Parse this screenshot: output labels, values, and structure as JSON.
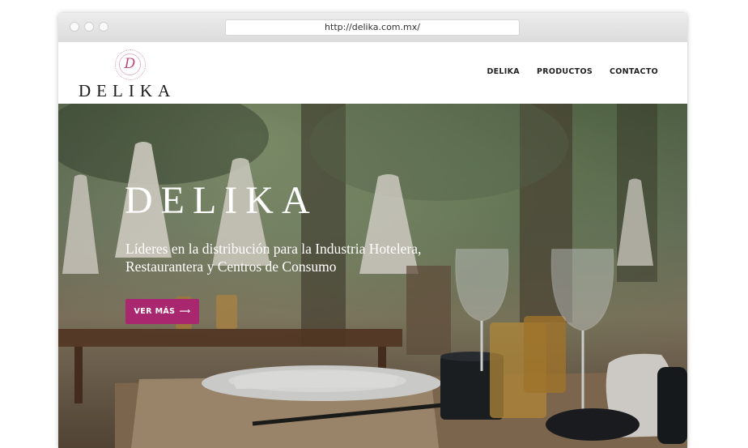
{
  "browser": {
    "url": "http://delika.com.mx/"
  },
  "header": {
    "logo_monogram": "D",
    "logo_text": "DELIKA",
    "nav": [
      "DELIKA",
      "PRODUCTOS",
      "CONTACTO"
    ]
  },
  "hero": {
    "title": "DELIKA",
    "subtitle_line1": "Líderes en la distribución para la Industria Hotelera,",
    "subtitle_line2": "Restaurantera y Centros de Consumo",
    "cta_label": "VER MÁS",
    "cta_arrow": "⟶"
  },
  "colors": {
    "accent": "#a9276f",
    "logo_pink": "#c0487e"
  }
}
